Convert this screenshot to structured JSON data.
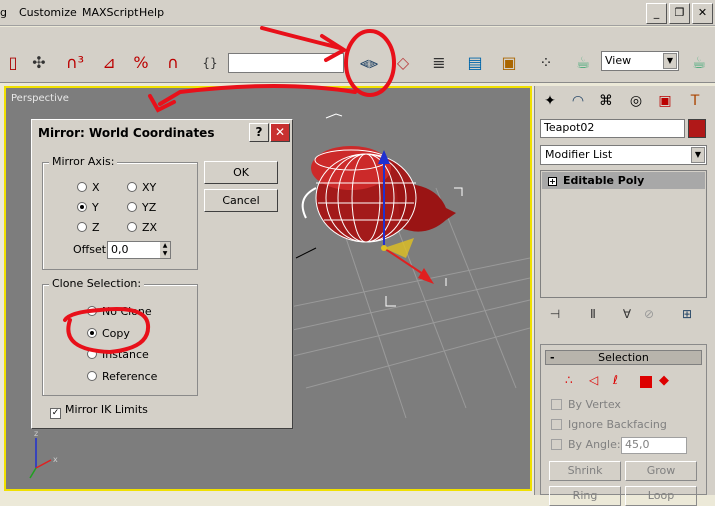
{
  "menu": {
    "items": [
      "g",
      "Customize",
      "MAXScript",
      "Help"
    ]
  },
  "window_buttons": {
    "minimize": "_",
    "restore": "❐",
    "close": "✕"
  },
  "toolbar": {
    "view_dropdown": "View",
    "icons": [
      "link-icon",
      "bind-space-warp-icon",
      "select-move-icon",
      "snap-angle-icon",
      "percent-snap-icon",
      "spinner-snap-icon",
      "named-selection-icon",
      "mirror-icon",
      "align-icon",
      "layer-manager-icon",
      "curve-editor-icon",
      "schematic-view-icon",
      "material-editor-icon",
      "render-scene-icon",
      "quick-render-icon"
    ]
  },
  "viewport": {
    "label": "Perspective"
  },
  "mirror_dialog": {
    "title": "Mirror: World Coordinates",
    "help_btn": "?",
    "close_btn": "✕",
    "mirror_axis": {
      "legend": "Mirror Axis:",
      "options": [
        {
          "label": "X",
          "selected": false
        },
        {
          "label": "XY",
          "selected": false
        },
        {
          "label": "Y",
          "selected": true
        },
        {
          "label": "YZ",
          "selected": false
        },
        {
          "label": "Z",
          "selected": false
        },
        {
          "label": "ZX",
          "selected": false
        }
      ],
      "offset_label": "Offset:",
      "offset_value": "0,0"
    },
    "clone_selection": {
      "legend": "Clone Selection:",
      "options": [
        {
          "label": "No Clone",
          "selected": false
        },
        {
          "label": "Copy",
          "selected": true
        },
        {
          "label": "Instance",
          "selected": false
        },
        {
          "label": "Reference",
          "selected": false
        }
      ]
    },
    "mirror_ik_label": "Mirror IK Limits",
    "mirror_ik_checked": true,
    "ok_label": "OK",
    "cancel_label": "Cancel"
  },
  "command_panel": {
    "object_name": "Teapot02",
    "object_color": "#b01818",
    "modifier_list": "Modifier List",
    "stack_item": "Editable Poly",
    "selection": {
      "title": "Selection",
      "by_vertex": "By Vertex",
      "ignore_backfacing": "Ignore Backfacing",
      "by_angle": "By Angle:",
      "angle_value": "45,0",
      "shrink": "Shrink",
      "grow": "Grow",
      "ring": "Ring",
      "loop": "Loop"
    }
  },
  "colors": {
    "annotation_red": "#e8101a",
    "viewport_border": "#f0e000",
    "teapot": "#b01818"
  }
}
